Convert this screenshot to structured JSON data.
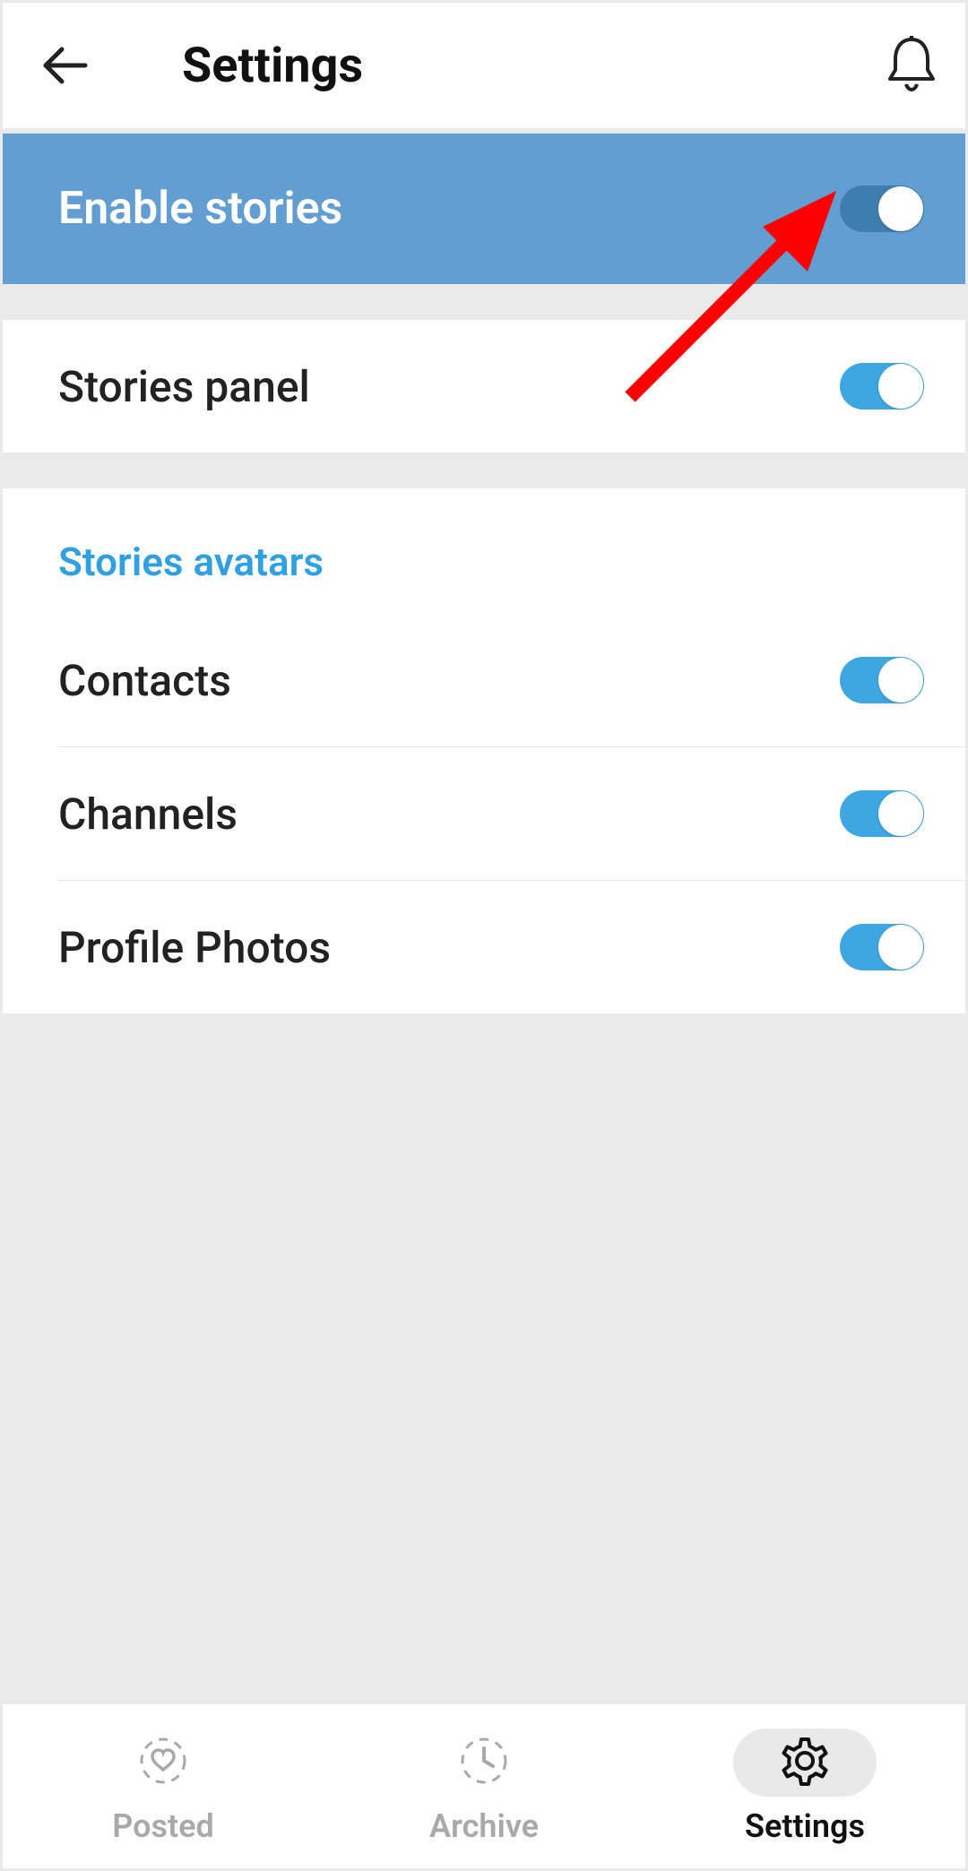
{
  "header": {
    "title": "Settings"
  },
  "enable_stories": {
    "label": "Enable stories",
    "on": true
  },
  "stories_panel": {
    "label": "Stories panel",
    "on": true
  },
  "avatars_section": {
    "title": "Stories avatars",
    "items": [
      {
        "label": "Contacts",
        "on": true
      },
      {
        "label": "Channels",
        "on": true
      },
      {
        "label": "Profile Photos",
        "on": true
      }
    ]
  },
  "nav": {
    "posted": "Posted",
    "archive": "Archive",
    "settings": "Settings"
  }
}
